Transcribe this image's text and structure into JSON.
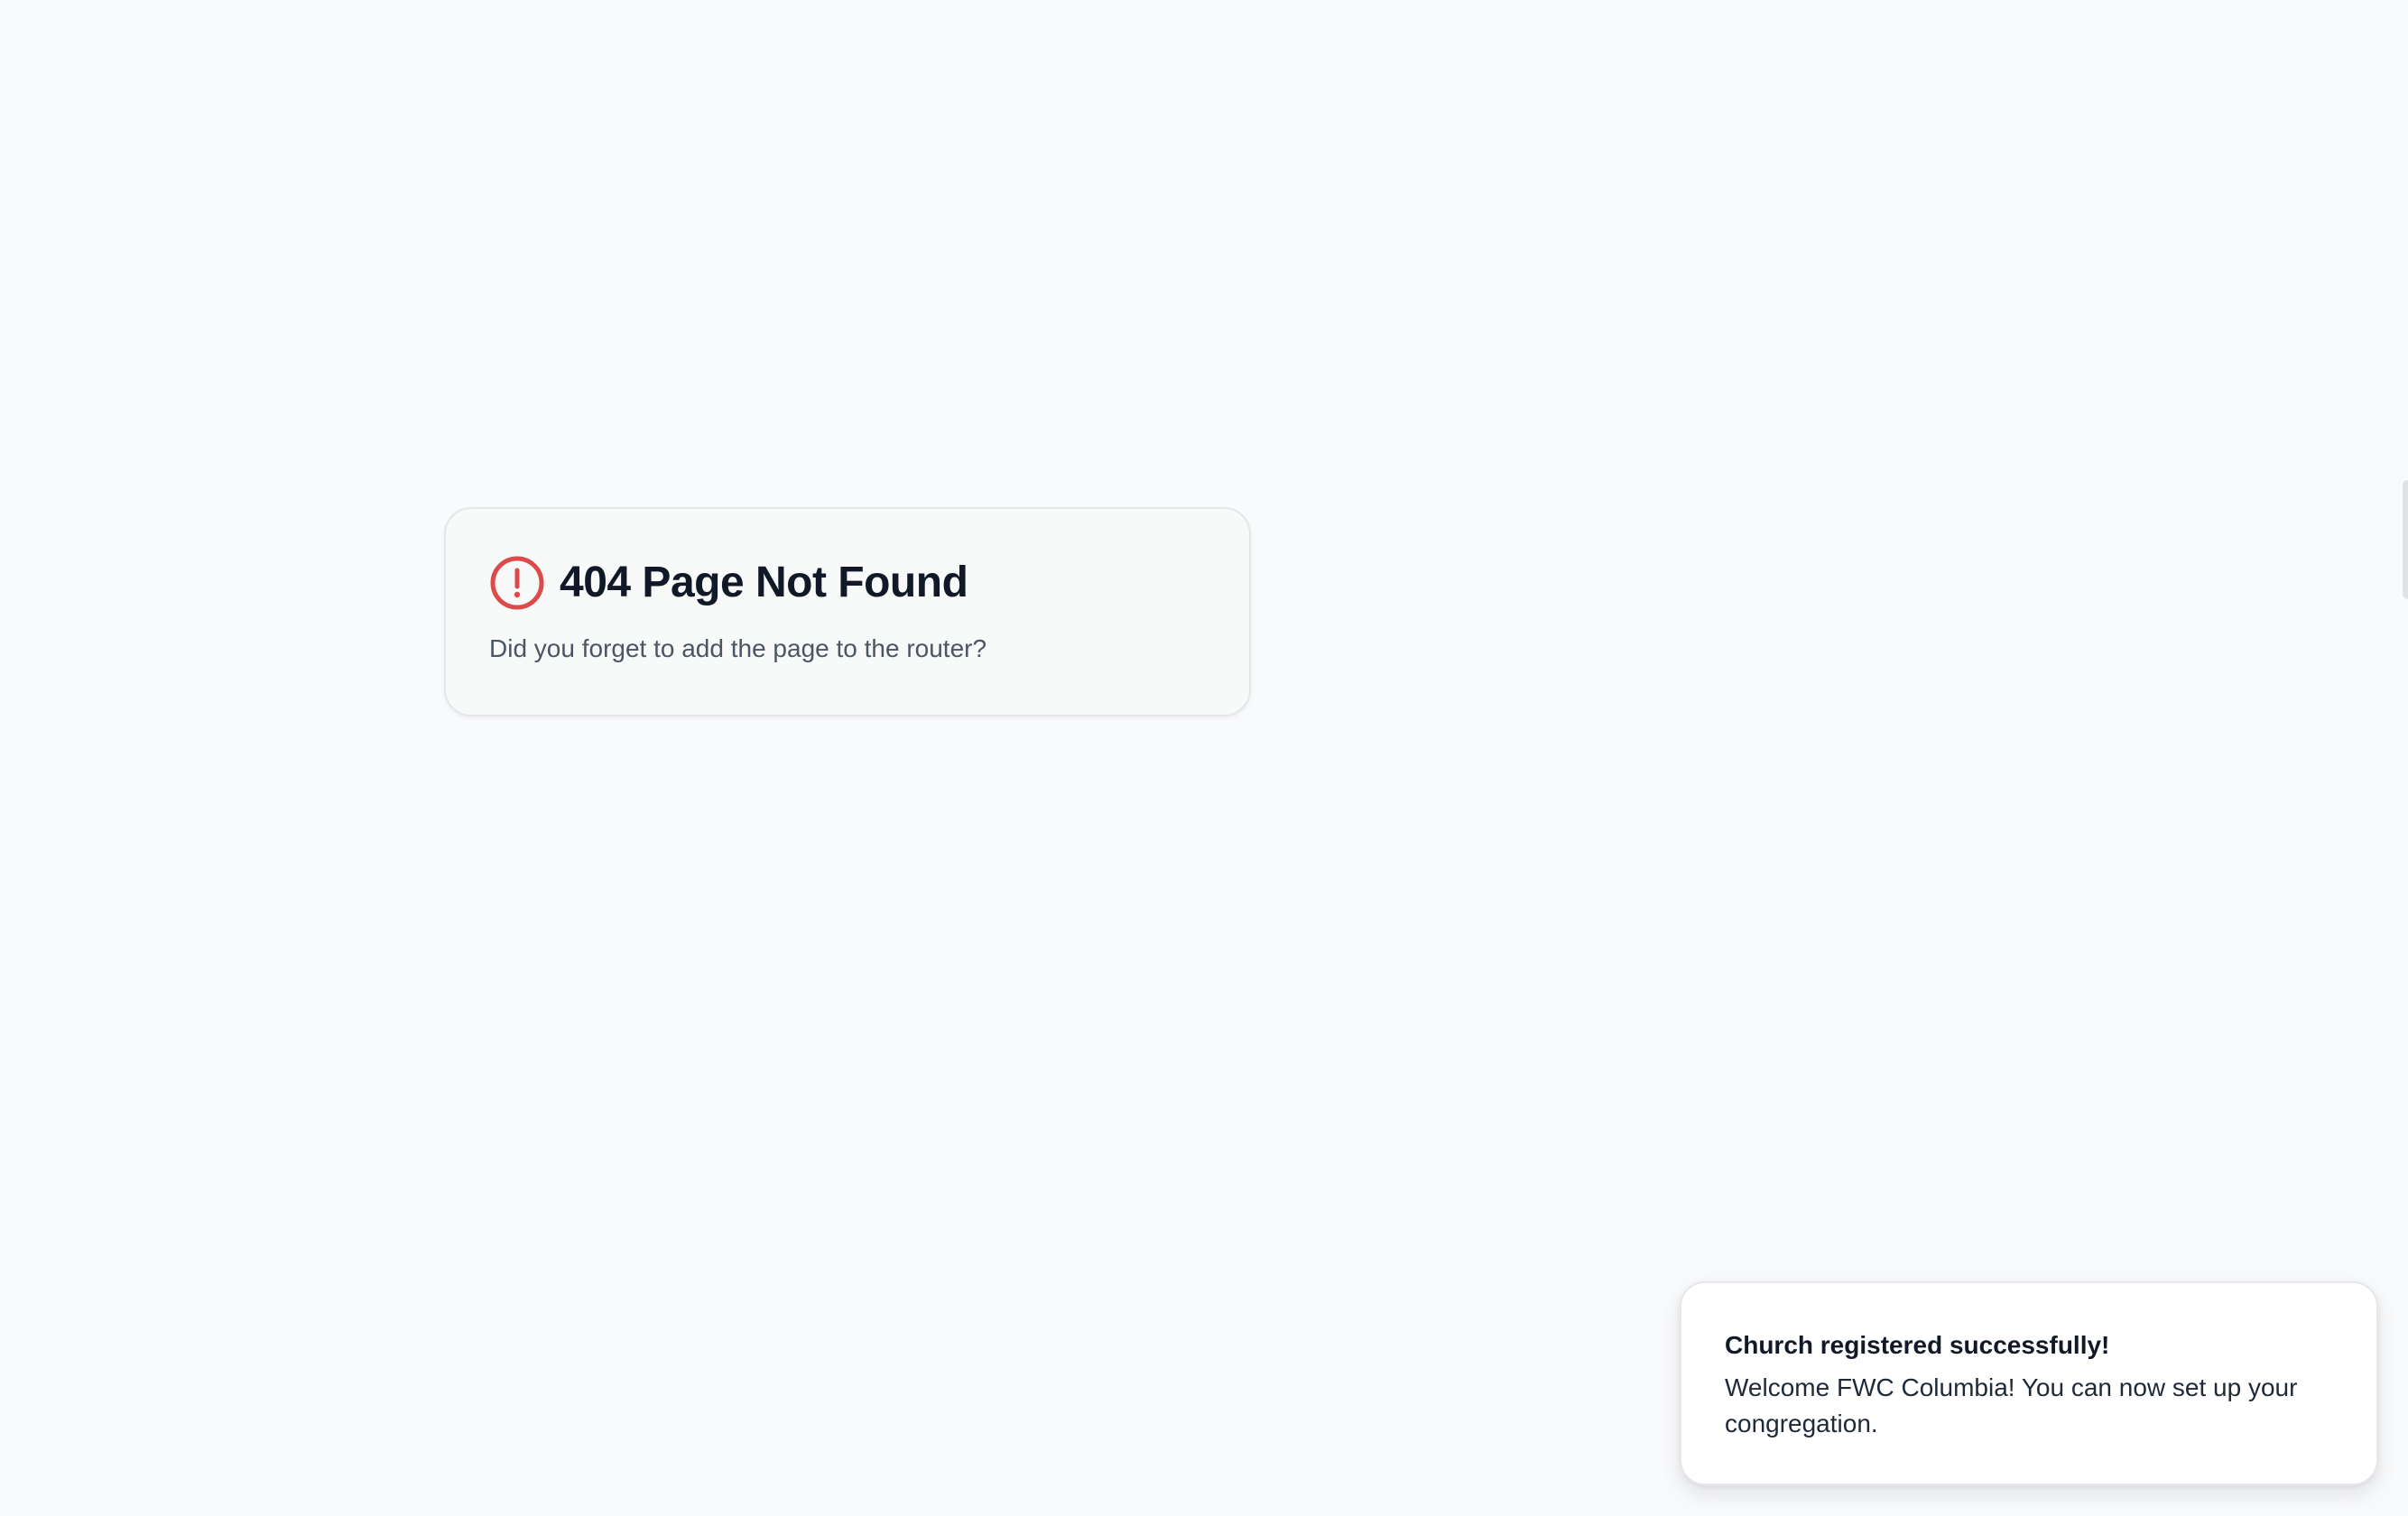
{
  "not_found": {
    "icon": "alert-circle-icon",
    "title": "404 Page Not Found",
    "description": "Did you forget to add the page to the router?"
  },
  "toast": {
    "title": "Church registered successfully!",
    "message": "Welcome FWC Columbia! You can now set up your congregation."
  },
  "colors": {
    "background": "#f9fafb",
    "alert_red": "#dc4a4a",
    "title_text": "#111827",
    "muted_text": "#4b5563"
  }
}
